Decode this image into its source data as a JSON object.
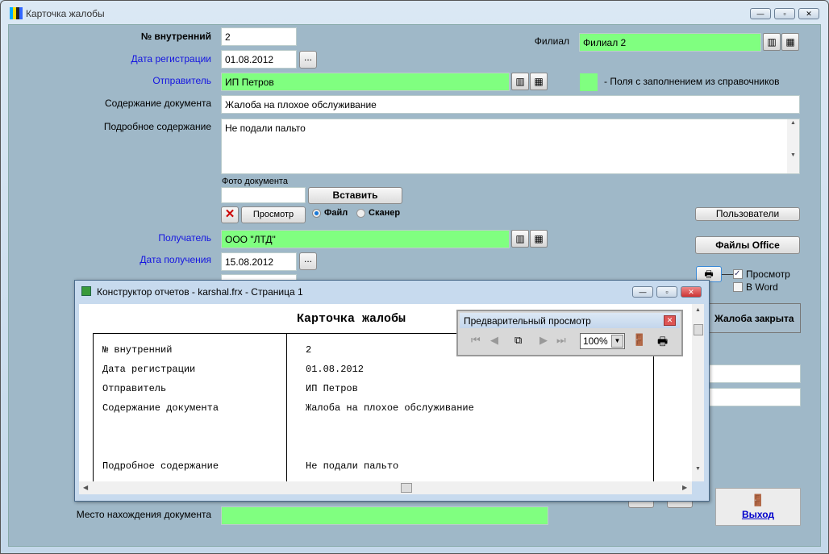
{
  "window": {
    "title": "Карточка жалобы"
  },
  "form": {
    "internal_no_label": "№ внутренний",
    "internal_no": "2",
    "reg_date_label": "Дата регистрации",
    "reg_date": "01.08.2012",
    "sender_label": "Отправитель",
    "sender": "ИП Петров",
    "content_label": "Содержание документа",
    "content": "Жалоба на плохое обслуживание",
    "detail_label": "Подробное содержание",
    "detail": "Не подали пальто",
    "photo_label": "Фото документа",
    "insert_btn": "Вставить",
    "view_btn": "Просмотр",
    "radio_file": "Файл",
    "radio_scanner": "Сканер",
    "recipient_label": "Получатель",
    "recipient": "ООО \"ЛТД\"",
    "recv_date_label": "Дата получения",
    "recv_date": "15.08.2012",
    "location_label": "Место нахождения документа",
    "location": "",
    "branch_label": "Филиал",
    "branch": "Филиал 2",
    "legend": "-  Поля с заполнением из справочников",
    "ellipsis": "...",
    "users_btn": "Пользователи",
    "office_btn": "Файлы Office",
    "print_preview": "Просмотр",
    "print_word": "В Word",
    "closed_btn": "Жалоба закрыта",
    "exit_btn": "Выход"
  },
  "report": {
    "title": "Конструктор отчетов - karshal.frx - Страница 1",
    "heading": "Карточка жалобы",
    "rows": [
      {
        "k": "№ внутренний",
        "v": "2"
      },
      {
        "k": "Дата регистрации",
        "v": "01.08.2012"
      },
      {
        "k": "Отправитель",
        "v": "ИП Петров"
      },
      {
        "k": "Содержание документа",
        "v": "Жалоба на плохое обслуживание"
      },
      {
        "k": "Подробное содержание",
        "v": "Не подали пальто"
      }
    ],
    "preview_title": "Предварительный просмотр",
    "zoom": "100%"
  },
  "colors": {
    "lookup_field": "#80ff80",
    "background": "#9fb8c8"
  }
}
